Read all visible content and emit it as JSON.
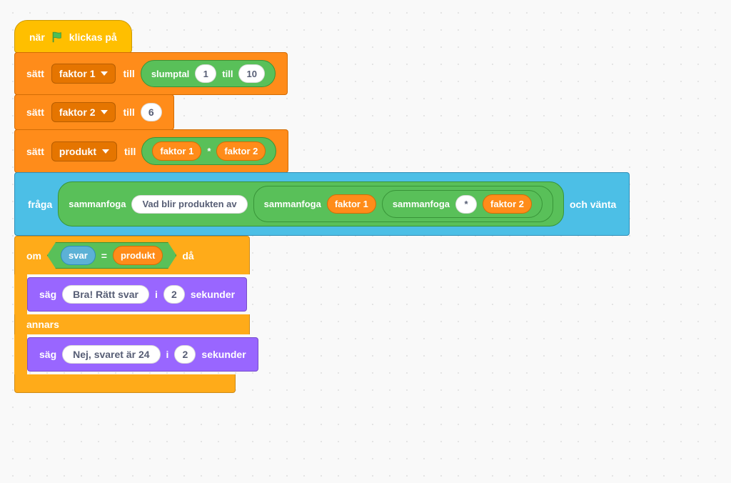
{
  "hat": {
    "prefix": "när",
    "suffix": "klickas på"
  },
  "set1": {
    "label_set": "sätt",
    "var": "faktor 1",
    "label_to": "till",
    "rand_label": "slumptal",
    "rand_from": "1",
    "rand_to_label": "till",
    "rand_to": "10"
  },
  "set2": {
    "label_set": "sätt",
    "var": "faktor 2",
    "label_to": "till",
    "value": "6"
  },
  "set3": {
    "label_set": "sätt",
    "var": "produkt",
    "label_to": "till",
    "lhs": "faktor 1",
    "op": "*",
    "rhs": "faktor 2"
  },
  "ask": {
    "label": "fråga",
    "join": "sammanfoga",
    "text1": "Vad blir produkten av",
    "var1": "faktor 1",
    "star": "*",
    "var2": "faktor 2",
    "wait": "och vänta"
  },
  "ifelse": {
    "if": "om",
    "then": "då",
    "else": "annars",
    "answer": "svar",
    "eq": "=",
    "produkt": "produkt"
  },
  "say1": {
    "label": "säg",
    "text": "Bra! Rätt svar",
    "in": "i",
    "secs": "2",
    "suffix": "sekunder"
  },
  "say2": {
    "label": "säg",
    "text": "Nej, svaret är 24",
    "in": "i",
    "secs": "2",
    "suffix": "sekunder"
  }
}
